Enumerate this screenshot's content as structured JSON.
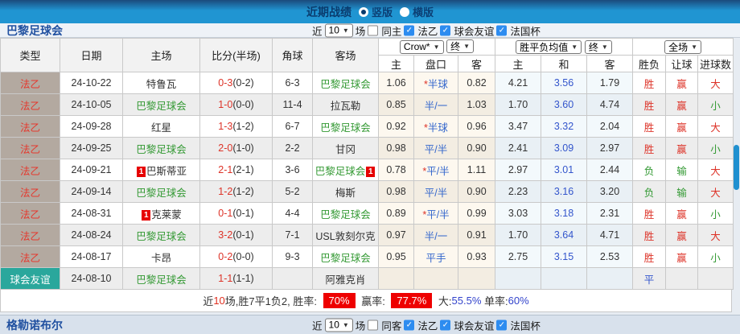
{
  "topbar": {
    "title": "近期战绩",
    "options": [
      {
        "label": "竖版",
        "selected": true
      },
      {
        "label": "横版",
        "selected": false
      }
    ]
  },
  "team_header": {
    "team_name": "巴黎足球会",
    "near_label": "近",
    "match_count": "10",
    "games_label": "场",
    "same_label": "同主",
    "filter_labels": [
      "法乙",
      "球会友谊",
      "法国杯"
    ]
  },
  "table": {
    "dropdowns": {
      "bookmaker": "Crow*",
      "final1": "终",
      "avg_label": "胜平负均值",
      "final2": "终",
      "scope": "全场"
    },
    "col_headers": {
      "type": "类型",
      "date": "日期",
      "home": "主场",
      "score": "比分(半场)",
      "corner": "角球",
      "away": "客场",
      "home_odds": "主",
      "line": "盘口",
      "away_odds": "客",
      "avg_home": "主",
      "avg_draw": "和",
      "avg_away": "客",
      "result": "胜负",
      "handicap": "让球",
      "goals": "进球数"
    },
    "rows": [
      {
        "type": "法乙",
        "type_cls": "league",
        "date": "24-10-22",
        "home": "特鲁瓦",
        "home_green": false,
        "home_badge": false,
        "score": "0-3",
        "half": "(0-2)",
        "corner": "6-3",
        "away": "巴黎足球会",
        "away_green": true,
        "away_badge": false,
        "o_h": "1.06",
        "o_star": true,
        "o_line": "半球",
        "o_a": "0.82",
        "v_h": "4.21",
        "v_d": "3.56",
        "v_a": "1.79",
        "res": "胜",
        "res_c": "red",
        "let": "赢",
        "let_c": "red",
        "goal": "大",
        "goal_c": "red"
      },
      {
        "type": "法乙",
        "type_cls": "league",
        "date": "24-10-05",
        "home": "巴黎足球会",
        "home_green": true,
        "home_badge": false,
        "score": "1-0",
        "half": "(0-0)",
        "corner": "11-4",
        "away": "拉瓦勒",
        "away_green": false,
        "away_badge": false,
        "o_h": "0.85",
        "o_star": false,
        "o_line": "半/一",
        "o_a": "1.03",
        "v_h": "1.70",
        "v_d": "3.60",
        "v_a": "4.74",
        "res": "胜",
        "res_c": "red",
        "let": "赢",
        "let_c": "red",
        "goal": "小",
        "goal_c": "green"
      },
      {
        "type": "法乙",
        "type_cls": "league",
        "date": "24-09-28",
        "home": "红星",
        "home_green": false,
        "home_badge": false,
        "score": "1-3",
        "half": "(1-2)",
        "corner": "6-7",
        "away": "巴黎足球会",
        "away_green": true,
        "away_badge": false,
        "o_h": "0.92",
        "o_star": true,
        "o_line": "半球",
        "o_a": "0.96",
        "v_h": "3.47",
        "v_d": "3.32",
        "v_a": "2.04",
        "res": "胜",
        "res_c": "red",
        "let": "赢",
        "let_c": "red",
        "goal": "大",
        "goal_c": "red"
      },
      {
        "type": "法乙",
        "type_cls": "league",
        "date": "24-09-25",
        "home": "巴黎足球会",
        "home_green": true,
        "home_badge": false,
        "score": "2-0",
        "half": "(1-0)",
        "corner": "2-2",
        "away": "甘冈",
        "away_green": false,
        "away_badge": false,
        "o_h": "0.98",
        "o_star": false,
        "o_line": "平/半",
        "o_a": "0.90",
        "v_h": "2.41",
        "v_d": "3.09",
        "v_a": "2.97",
        "res": "胜",
        "res_c": "red",
        "let": "赢",
        "let_c": "red",
        "goal": "小",
        "goal_c": "green"
      },
      {
        "type": "法乙",
        "type_cls": "league",
        "date": "24-09-21",
        "home": "巴斯蒂亚",
        "home_green": false,
        "home_badge": true,
        "score": "2-1",
        "half": "(2-1)",
        "corner": "3-6",
        "away": "巴黎足球会",
        "away_green": true,
        "away_badge": true,
        "o_h": "0.78",
        "o_star": true,
        "o_line": "平/半",
        "o_a": "1.11",
        "v_h": "2.97",
        "v_d": "3.01",
        "v_a": "2.44",
        "res": "负",
        "res_c": "green",
        "let": "输",
        "let_c": "green",
        "goal": "大",
        "goal_c": "red"
      },
      {
        "type": "法乙",
        "type_cls": "league",
        "date": "24-09-14",
        "home": "巴黎足球会",
        "home_green": true,
        "home_badge": false,
        "score": "1-2",
        "half": "(1-2)",
        "corner": "5-2",
        "away": "梅斯",
        "away_green": false,
        "away_badge": false,
        "o_h": "0.98",
        "o_star": false,
        "o_line": "平/半",
        "o_a": "0.90",
        "v_h": "2.23",
        "v_d": "3.16",
        "v_a": "3.20",
        "res": "负",
        "res_c": "green",
        "let": "输",
        "let_c": "green",
        "goal": "大",
        "goal_c": "red"
      },
      {
        "type": "法乙",
        "type_cls": "league",
        "date": "24-08-31",
        "home": "克莱蒙",
        "home_green": false,
        "home_badge": true,
        "score": "0-1",
        "half": "(0-1)",
        "corner": "4-4",
        "away": "巴黎足球会",
        "away_green": true,
        "away_badge": false,
        "o_h": "0.89",
        "o_star": true,
        "o_line": "平/半",
        "o_a": "0.99",
        "v_h": "3.03",
        "v_d": "3.18",
        "v_a": "2.31",
        "res": "胜",
        "res_c": "red",
        "let": "赢",
        "let_c": "red",
        "goal": "小",
        "goal_c": "green"
      },
      {
        "type": "法乙",
        "type_cls": "league",
        "date": "24-08-24",
        "home": "巴黎足球会",
        "home_green": true,
        "home_badge": false,
        "score": "3-2",
        "half": "(0-1)",
        "corner": "7-1",
        "away": "USL敦刻尔克",
        "away_green": false,
        "away_badge": false,
        "o_h": "0.97",
        "o_star": false,
        "o_line": "半/一",
        "o_a": "0.91",
        "v_h": "1.70",
        "v_d": "3.64",
        "v_a": "4.71",
        "res": "胜",
        "res_c": "red",
        "let": "赢",
        "let_c": "red",
        "goal": "大",
        "goal_c": "red"
      },
      {
        "type": "法乙",
        "type_cls": "league",
        "date": "24-08-17",
        "home": "卡昂",
        "home_green": false,
        "home_badge": false,
        "score": "0-2",
        "half": "(0-0)",
        "corner": "9-3",
        "away": "巴黎足球会",
        "away_green": true,
        "away_badge": false,
        "o_h": "0.95",
        "o_star": false,
        "o_line": "平手",
        "o_a": "0.93",
        "v_h": "2.75",
        "v_d": "3.15",
        "v_a": "2.53",
        "res": "胜",
        "res_c": "red",
        "let": "赢",
        "let_c": "red",
        "goal": "小",
        "goal_c": "green"
      },
      {
        "type": "球会友谊",
        "type_cls": "friendly",
        "date": "24-08-10",
        "home": "巴黎足球会",
        "home_green": true,
        "home_badge": false,
        "score": "1-1",
        "half": "(1-1)",
        "corner": "",
        "away": "阿雅克肖",
        "away_green": false,
        "away_badge": false,
        "o_h": "",
        "o_star": false,
        "o_line": "",
        "o_a": "",
        "v_h": "",
        "v_d": "",
        "v_a": "",
        "res": "平",
        "res_c": "blue",
        "let": "",
        "let_c": "dark",
        "goal": "",
        "goal_c": "dark"
      }
    ]
  },
  "summary": {
    "segments": [
      {
        "text": "近",
        "style": "dark"
      },
      {
        "text": "10",
        "style": "red"
      },
      {
        "text": "场,胜7平1负2, 胜率: ",
        "style": "dark"
      },
      {
        "text": "70%",
        "style": "badge"
      },
      {
        "text": " 赢率: ",
        "style": "dark"
      },
      {
        "text": "77.7%",
        "style": "badge"
      },
      {
        "text": " 大:",
        "style": "dark"
      },
      {
        "text": "55.5%",
        "style": "blue"
      },
      {
        "text": " 单率:",
        "style": "dark"
      },
      {
        "text": "60%",
        "style": "blue"
      }
    ]
  },
  "bottom_header": {
    "team_name": "格勒诺布尔",
    "near_label": "近",
    "match_count": "10",
    "games_label": "场",
    "same_label": "同客",
    "filter_labels": [
      "法乙",
      "球会友谊",
      "法国杯"
    ]
  },
  "colors": {
    "accent_blue": "#2095d2",
    "win_red": "#dd3328",
    "loss_green": "#339933",
    "odds_blue": "#3366cc",
    "type_cell_bg": "#b3a9a0",
    "friendly_cell_bg": "#2aa79c",
    "rate_badge_bg": "#ee0000"
  }
}
